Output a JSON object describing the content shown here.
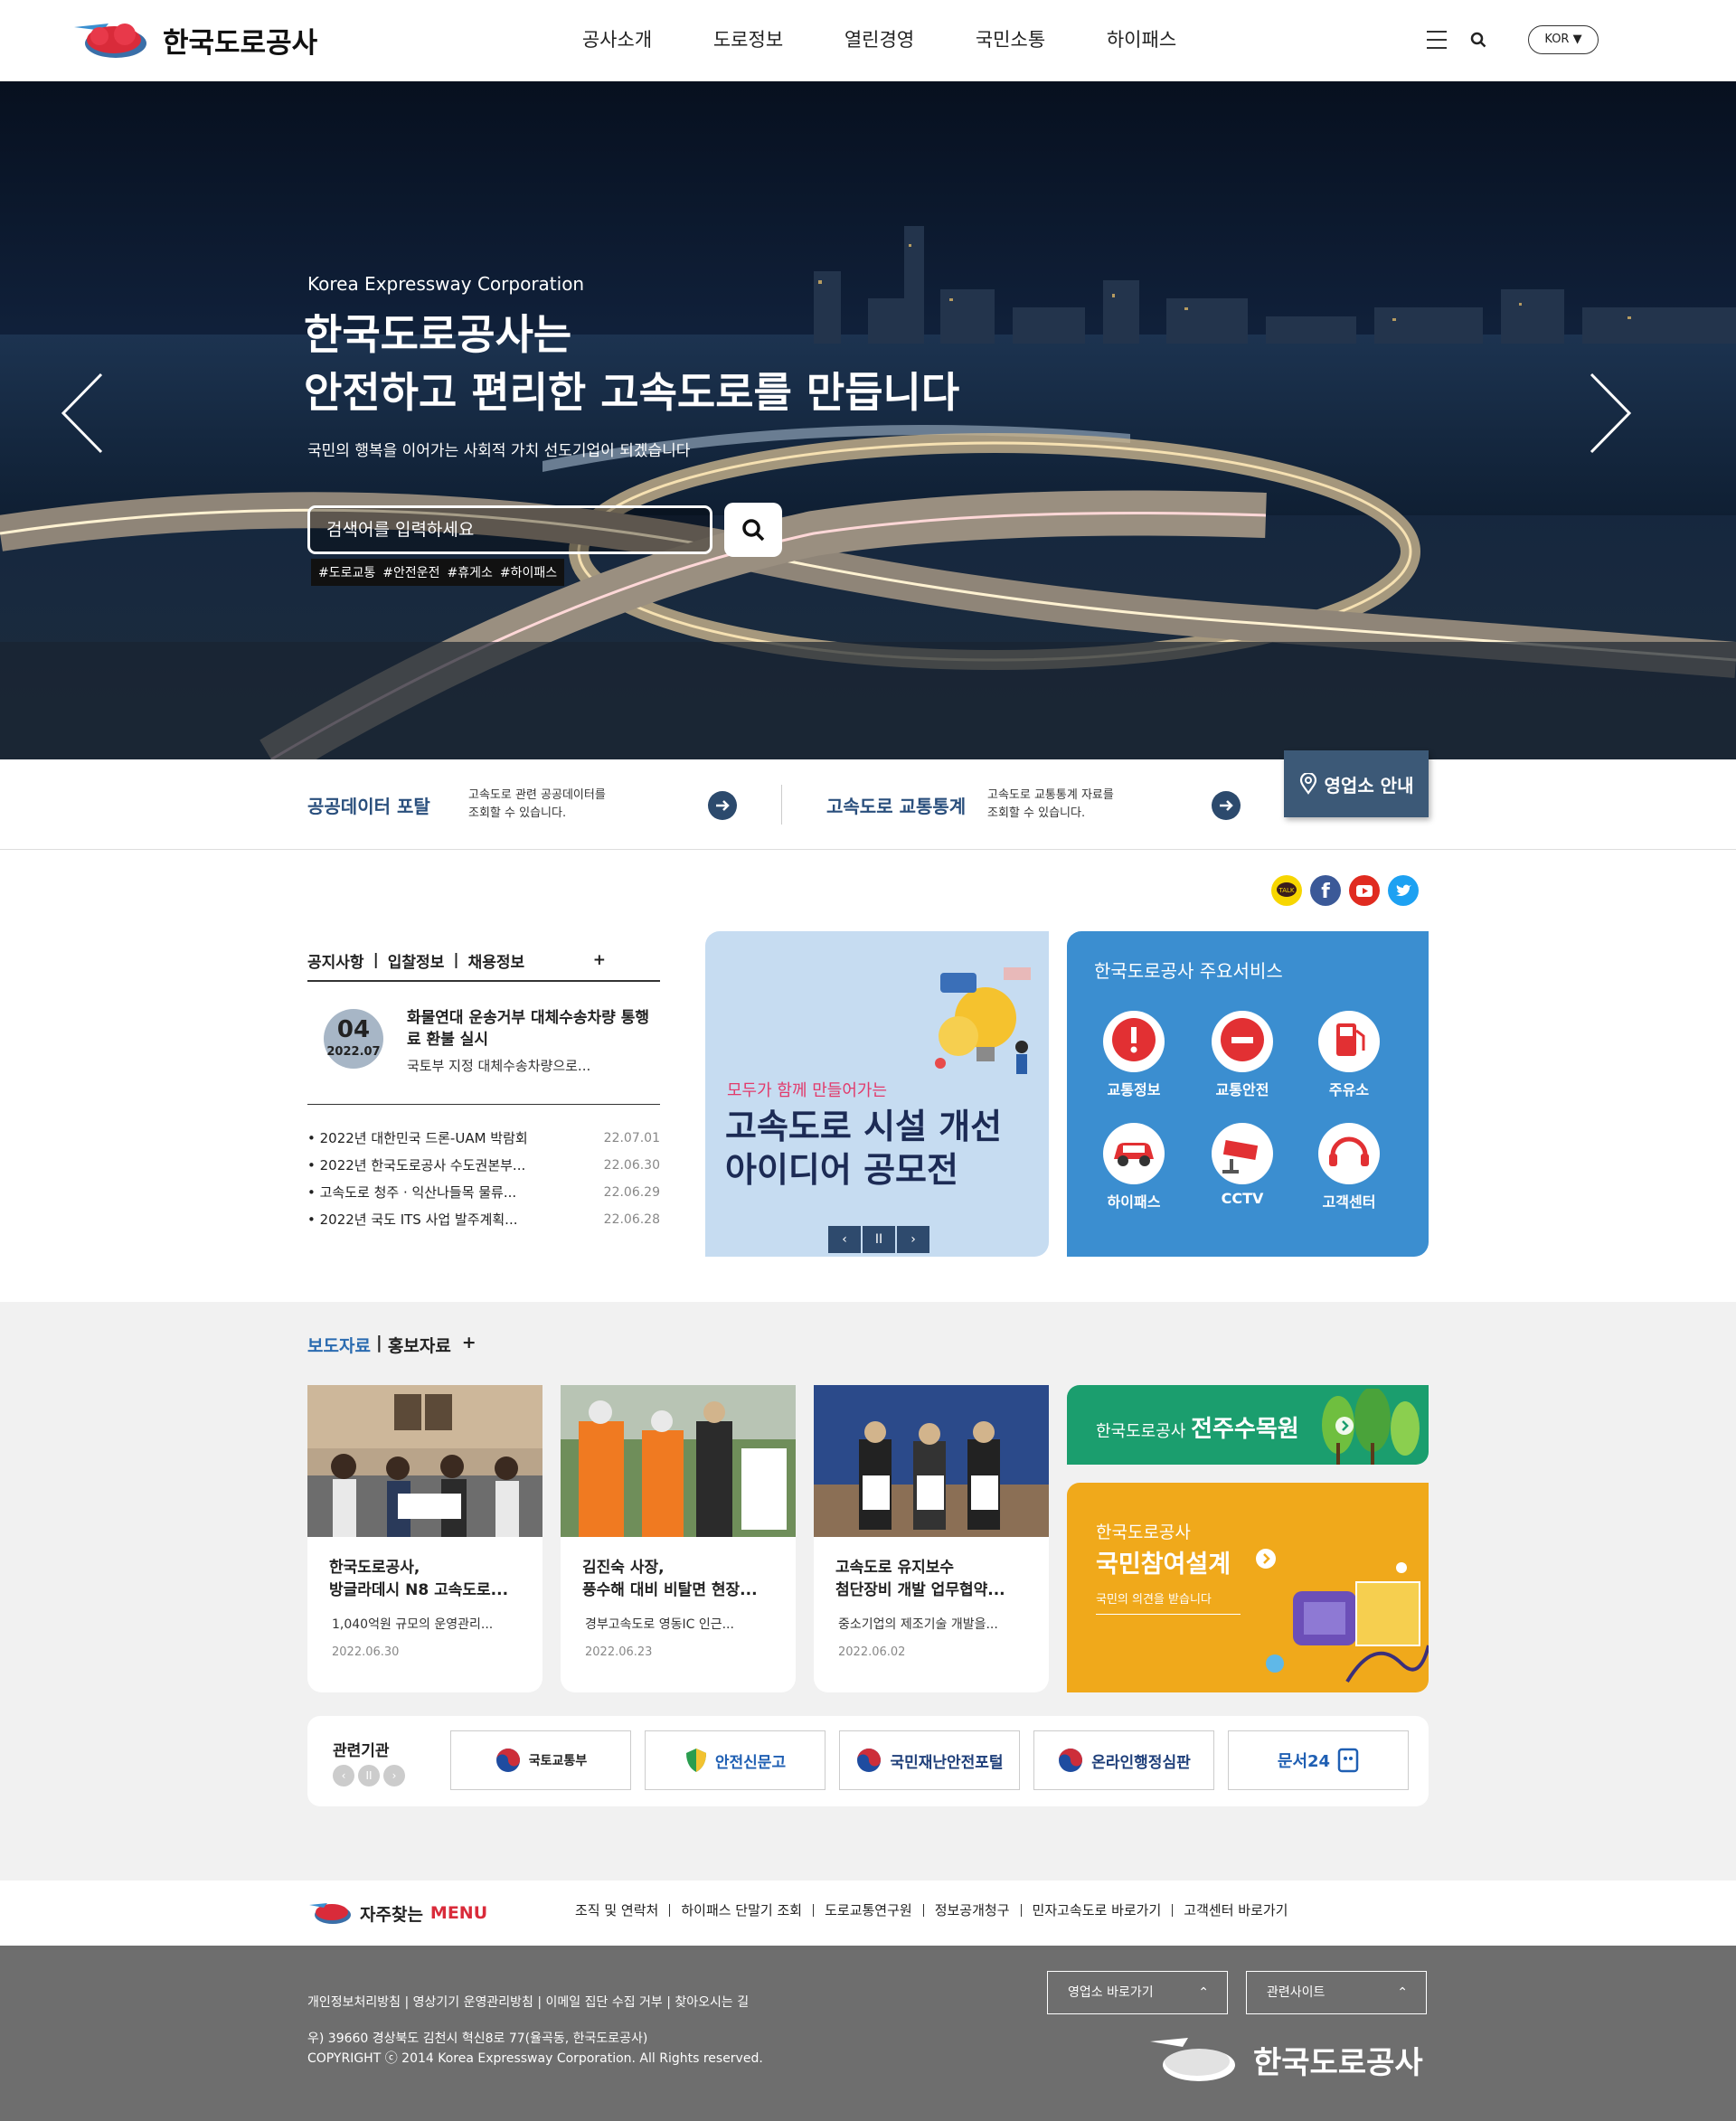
{
  "header": {
    "brand": "한국도로공사",
    "nav": [
      "공사소개",
      "도로정보",
      "열린경영",
      "국민소통",
      "하이패스"
    ],
    "lang": "KOR ▼"
  },
  "hero": {
    "eyebrow": "Korea Expressway Corporation",
    "title": "한국도로공사는\n안전하고 편리한 고속도로를 만듭니다",
    "desc": "국민의 행복을 이어가는 사회적 가치 선도기업이 되겠습니다",
    "search_placeholder": "검색어를 입력하세요",
    "tags": [
      "#도로교통",
      "#안전운전",
      "#휴게소",
      "#하이패스"
    ]
  },
  "quick": [
    {
      "title": "공공데이터 포탈",
      "desc1": "고속도로 관련 공공데이터를",
      "desc2": "조회할 수 있습니다."
    },
    {
      "title": "고속도로 교통통계",
      "desc1": "고속도로 교통통계 자료를",
      "desc2": "조회할 수 있습니다."
    }
  ],
  "branch_label": "영업소 안내",
  "notice": {
    "tabs": [
      "공지사항",
      "입찰정보",
      "채용정보"
    ],
    "plus": "+",
    "main": {
      "day": "04",
      "ym": "2022.07",
      "title": "화물연대 운송거부 대체수송차량 통행료 환불 실시",
      "desc": "국토부 지정 대체수송차량으로..."
    },
    "list": [
      {
        "title": "• 2022년 대한민국 드론-UAM 박람회",
        "date": "22.07.01"
      },
      {
        "title": "• 2022년 한국도로공사 수도권본부...",
        "date": "22.06.30"
      },
      {
        "title": "• 고속도로 청주 · 익산나들목 물류...",
        "date": "22.06.29"
      },
      {
        "title": "• 2022년 국도 ITS 사업 발주계획...",
        "date": "22.06.28"
      }
    ]
  },
  "banner": {
    "small": "모두가 함께 만들어가는",
    "big": "고속도로 시설 개선\n아이디어 공모전",
    "ctrl": [
      "‹",
      "II",
      "›"
    ]
  },
  "services": {
    "title": "한국도로공사 주요서비스",
    "items": [
      "교통정보",
      "교통안전",
      "주유소",
      "하이패스",
      "CCTV",
      "고객센터"
    ]
  },
  "press": {
    "tabs": [
      "보도자료",
      "|",
      "홍보자료",
      "+"
    ],
    "cards": [
      {
        "title": "한국도로공사,\n방글라데시 N8 고속도로...",
        "desc": "1,040억원 규모의 운영관리...",
        "date": "2022.06.30"
      },
      {
        "title": "김진숙 사장,\n풍수해 대비 비탈면 현장...",
        "desc": "경부고속도로 영동IC 인근...",
        "date": "2022.06.23"
      },
      {
        "title": "고속도로 유지보수\n첨단장비 개발 업무협약...",
        "desc": "중소기업의 제조기술 개발을...",
        "date": "2022.06.02"
      }
    ]
  },
  "promo": {
    "jj_prefix": "한국도로공사",
    "jj_main": "전주수목원",
    "pp_prefix": "한국도로공사",
    "pp_main": "국민참여설계",
    "pp_sub": "국민의 의견을 받습니다"
  },
  "related": {
    "title": "관련기관",
    "logos": [
      "국토교통부",
      "안전신문고",
      "국민재난안전포털",
      "온라인행정심판",
      "문서24"
    ]
  },
  "freq": {
    "title": "자주찾는",
    "accent": "MENU",
    "links": [
      "조직 및 연락처",
      "하이패스 단말기 조회",
      "도로교통연구원",
      "정보공개청구",
      "민자고속도로 바로가기",
      "고객센터 바로가기"
    ]
  },
  "footer": {
    "links": "개인정보처리방침 | 영상기기 운영관리방침 | 이메일 집단 수집 거부 | 찾아오시는 길",
    "addr": "우) 39660 경상북도 김천시 혁신8로 77(율곡동, 한국도로공사)",
    "copy": "COPYRIGHT ⓒ 2014 Korea Expressway Corporation. All Rights reserved.",
    "sel1": "영업소 바로가기",
    "sel2": "관련사이트",
    "brand": "한국도로공사"
  }
}
